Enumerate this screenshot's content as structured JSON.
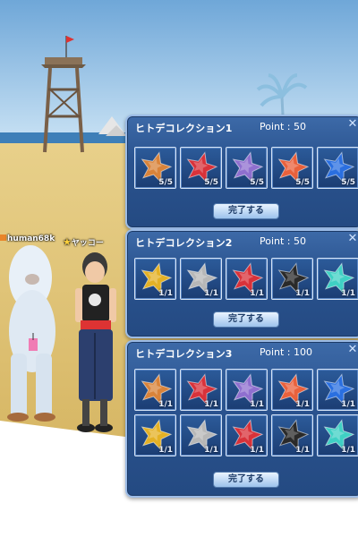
{
  "players": [
    {
      "name": "human68k",
      "icon": "orange-guild-icon"
    },
    {
      "name": "ヤッコー",
      "icon": "gold-star-icon"
    }
  ],
  "panels": [
    {
      "title": "ヒトデコレクション1",
      "point_label": "Point : 50",
      "button": "完了する",
      "slots": [
        {
          "color": "orange-star",
          "count": "5/5"
        },
        {
          "color": "red-star",
          "count": "5/5"
        },
        {
          "color": "purple-star",
          "count": "5/5"
        },
        {
          "color": "coral-star",
          "count": "5/5"
        },
        {
          "color": "blue-star",
          "count": "5/5"
        }
      ]
    },
    {
      "title": "ヒトデコレクション2",
      "point_label": "Point : 50",
      "button": "完了する",
      "slots": [
        {
          "color": "gold-star",
          "count": "1/1"
        },
        {
          "color": "silver-star",
          "count": "1/1"
        },
        {
          "color": "red-star",
          "count": "1/1"
        },
        {
          "color": "black-star",
          "count": "1/1"
        },
        {
          "color": "teal-star",
          "count": "1/1"
        }
      ]
    },
    {
      "title": "ヒトデコレクション3",
      "point_label": "Point : 100",
      "button": "完了する",
      "slots": [
        {
          "color": "orange-star",
          "count": "1/1"
        },
        {
          "color": "red-star",
          "count": "1/1"
        },
        {
          "color": "purple-star",
          "count": "1/1"
        },
        {
          "color": "coral-star",
          "count": "1/1"
        },
        {
          "color": "blue-star",
          "count": "1/1"
        },
        {
          "color": "gold-star",
          "count": "1/1"
        },
        {
          "color": "silver-star",
          "count": "1/1"
        },
        {
          "color": "red-star",
          "count": "1/1"
        },
        {
          "color": "black-star",
          "count": "1/1"
        },
        {
          "color": "teal-star",
          "count": "1/1"
        }
      ]
    }
  ],
  "colors": {
    "panel_bg": "#2a538f",
    "panel_border": "#9bbbe6",
    "sky": "#9ec9ea",
    "sand": "#e2c87a",
    "orange-star": "#d9833a",
    "red-star": "#d8323a",
    "purple-star": "#8f6fcf",
    "coral-star": "#e8613c",
    "blue-star": "#2a6fe0",
    "gold-star": "#e4b125",
    "silver-star": "#b7b7b7",
    "black-star": "#2a2a2a",
    "teal-star": "#3fd0c4"
  }
}
